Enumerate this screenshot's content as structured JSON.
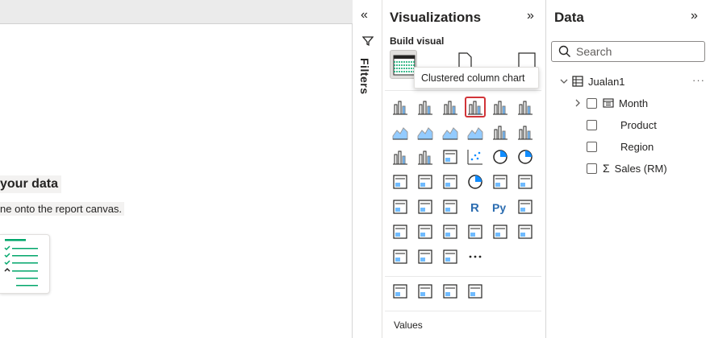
{
  "canvas": {
    "heading": "your data",
    "subtext": "ne onto the report canvas."
  },
  "filters": {
    "label": "Filters",
    "collapse_glyph": "«"
  },
  "visualizations": {
    "title": "Visualizations",
    "expand_glyph": "»",
    "build_visual_label": "Build visual",
    "tooltip": "Clustered column chart",
    "more_glyph": "···",
    "values_label": "Values",
    "icons": [
      "stacked-bar-chart-icon",
      "stacked-column-chart-icon",
      "clustered-bar-chart-icon",
      "clustered-column-chart-icon",
      "100-stacked-bar-chart-icon",
      "100-stacked-column-chart-icon",
      "line-chart-icon",
      "area-chart-icon",
      "stacked-area-chart-icon",
      "100-stacked-area-chart-icon",
      "line-and-stacked-column-chart-icon",
      "line-and-clustered-column-chart-icon",
      "ribbon-chart-icon",
      "waterfall-chart-icon",
      "funnel-chart-icon",
      "scatter-chart-icon",
      "pie-chart-icon",
      "donut-chart-icon",
      "treemap-icon",
      "map-icon",
      "azure-map-icon",
      "gauge-icon",
      "card-icon",
      "kpi-icon",
      "slicer-icon",
      "table-icon",
      "matrix-icon",
      "r-visual-icon",
      "python-visual-icon",
      "key-influencers-icon",
      "decomposition-tree-icon",
      "qa-icon",
      "paginated-report-icon",
      "smart-narrative-icon",
      "metrics-icon",
      "image-icon",
      "power-apps-icon",
      "power-automate-icon",
      "arcgis-icon",
      "more-visuals-icon"
    ],
    "extra_icons": [
      "globe-map-icon",
      "filled-map-icon",
      "trophy-icon",
      "custom-visual-icon"
    ]
  },
  "data": {
    "title": "Data",
    "expand_glyph": "»",
    "search_placeholder": "Search",
    "table_name": "Jualan1",
    "more_glyph": "···",
    "fields": [
      {
        "label": "Month",
        "type": "hierarchy"
      },
      {
        "label": "Product",
        "type": "text"
      },
      {
        "label": "Region",
        "type": "text"
      },
      {
        "label": "Sales (RM)",
        "type": "sum"
      }
    ]
  },
  "colors": {
    "accent_teal": "#118dff",
    "icon_dark": "#252423",
    "selected_border": "#d13438",
    "checklist_green": "#00a66a"
  }
}
